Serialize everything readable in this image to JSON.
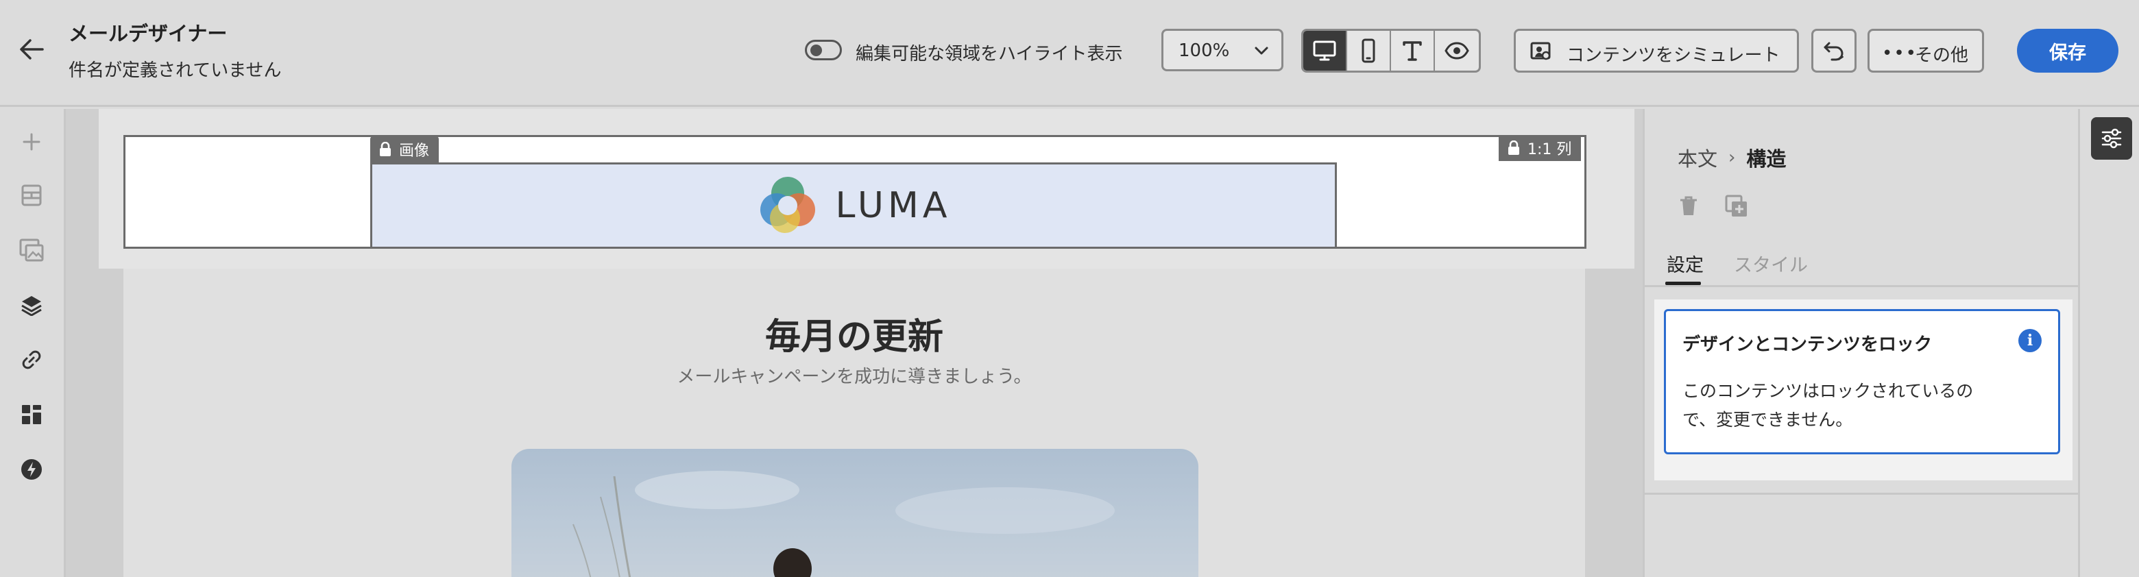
{
  "header": {
    "title": "メールデザイナー",
    "subtitle": "件名が定義されていません",
    "highlight_toggle_label": "編集可能な領域をハイライト表示",
    "highlight_toggle_on": false,
    "zoom_value": "100%",
    "view_modes": [
      {
        "name": "desktop",
        "icon": "desktop-icon",
        "active": true
      },
      {
        "name": "mobile",
        "icon": "mobile-icon",
        "active": false
      },
      {
        "name": "text",
        "icon": "text-icon",
        "active": false
      },
      {
        "name": "preview",
        "icon": "eye-icon",
        "active": false
      }
    ],
    "simulate_label": "コンテンツをシミュレート",
    "more_label": "その他",
    "save_label": "保存"
  },
  "left_rail": {
    "icons": [
      "plus-icon",
      "structure-icon",
      "image-gallery-icon",
      "layers-icon",
      "link-icon",
      "fragments-icon",
      "lightning-icon"
    ]
  },
  "canvas": {
    "image_tag_label": "画像",
    "column_tag_label": "1:1 列",
    "logo_text": "LUMA",
    "headline": "毎月の更新",
    "tagline": "メールキャンペーンを成功に導きましょう。"
  },
  "right_panel": {
    "breadcrumb": {
      "parent": "本文",
      "separator": "›",
      "current": "構造"
    },
    "tabs": [
      {
        "label": "設定",
        "active": true
      },
      {
        "label": "スタイル",
        "active": false
      }
    ],
    "lock_card": {
      "title": "デザインとコンテンツをロック",
      "description": "このコンテンツはロックされているので、変更できません。"
    }
  },
  "colors": {
    "accent": "#2b6ccf",
    "background": "#dcdcdc",
    "active_toggle_bg": "#3a3a3a"
  }
}
